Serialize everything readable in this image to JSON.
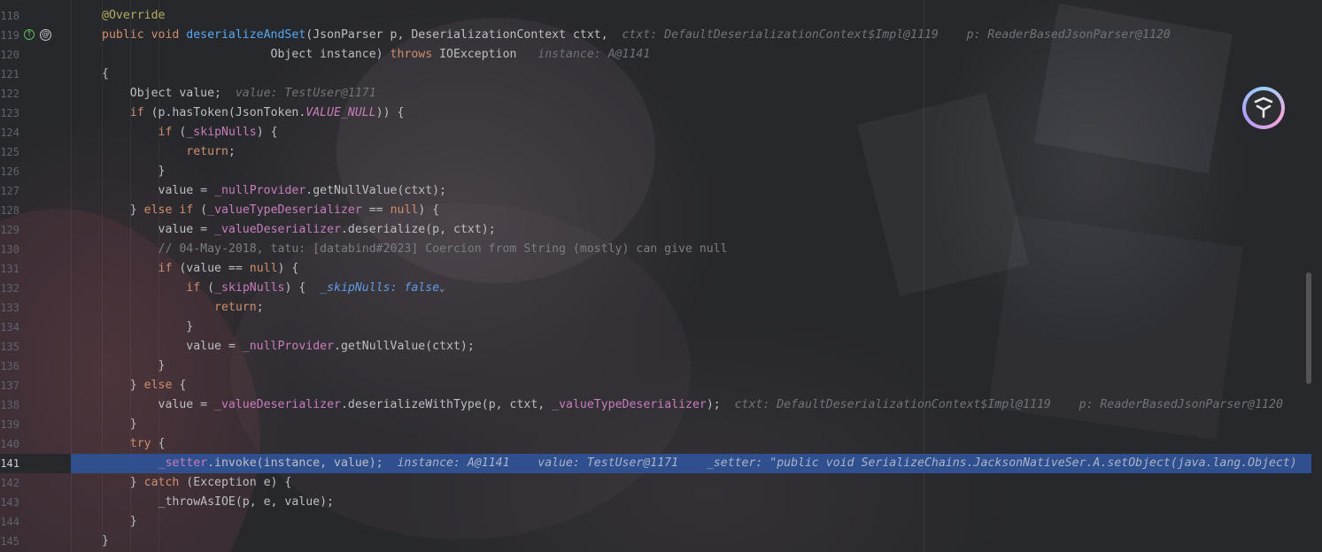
{
  "editor": {
    "lines": [
      {
        "num": "118",
        "tokens": [
          {
            "t": "@Override",
            "c": "anno"
          }
        ]
      },
      {
        "num": "119",
        "icons": [
          "override-marker",
          "annotation-marker"
        ],
        "tokens": [
          {
            "t": "public ",
            "c": "kw"
          },
          {
            "t": "void ",
            "c": "kw"
          },
          {
            "t": "deserializeAndSet",
            "c": "fn"
          },
          {
            "t": "(JsonParser p, DeserializationContext ctxt,  ",
            "c": ""
          },
          {
            "t": "ctxt: DefaultDeserializationContext$Impl@1119    p: ReaderBasedJsonParser@1120",
            "c": "hint"
          }
        ]
      },
      {
        "num": "120",
        "tokens": [
          {
            "t": "                        Object instance) ",
            "c": ""
          },
          {
            "t": "throws ",
            "c": "kw"
          },
          {
            "t": "IOException   ",
            "c": ""
          },
          {
            "t": "instance: A@1141",
            "c": "hint"
          }
        ]
      },
      {
        "num": "121",
        "tokens": [
          {
            "t": "{",
            "c": ""
          }
        ]
      },
      {
        "num": "122",
        "tokens": [
          {
            "t": "    Object value;  ",
            "c": ""
          },
          {
            "t": "value: TestUser@1171",
            "c": "hint"
          }
        ]
      },
      {
        "num": "123",
        "tokens": [
          {
            "t": "    ",
            "c": ""
          },
          {
            "t": "if ",
            "c": "kw"
          },
          {
            "t": "(p.hasToken(JsonToken.",
            "c": ""
          },
          {
            "t": "VALUE_NULL",
            "c": "const"
          },
          {
            "t": ")) {",
            "c": ""
          }
        ]
      },
      {
        "num": "124",
        "tokens": [
          {
            "t": "        ",
            "c": ""
          },
          {
            "t": "if ",
            "c": "kw"
          },
          {
            "t": "(",
            "c": ""
          },
          {
            "t": "_skipNulls",
            "c": "field"
          },
          {
            "t": ") {",
            "c": ""
          }
        ]
      },
      {
        "num": "125",
        "tokens": [
          {
            "t": "            ",
            "c": ""
          },
          {
            "t": "return",
            "c": "kw"
          },
          {
            "t": ";",
            "c": ""
          }
        ]
      },
      {
        "num": "126",
        "tokens": [
          {
            "t": "        }",
            "c": ""
          }
        ]
      },
      {
        "num": "127",
        "tokens": [
          {
            "t": "        value = ",
            "c": ""
          },
          {
            "t": "_nullProvider",
            "c": "field"
          },
          {
            "t": ".getNullValue(ctxt);",
            "c": ""
          }
        ]
      },
      {
        "num": "128",
        "tokens": [
          {
            "t": "    } ",
            "c": ""
          },
          {
            "t": "else if ",
            "c": "kw"
          },
          {
            "t": "(",
            "c": ""
          },
          {
            "t": "_valueTypeDeserializer",
            "c": "field"
          },
          {
            "t": " == ",
            "c": ""
          },
          {
            "t": "null",
            "c": "kw"
          },
          {
            "t": ") {",
            "c": ""
          }
        ]
      },
      {
        "num": "129",
        "tokens": [
          {
            "t": "        value = ",
            "c": ""
          },
          {
            "t": "_valueDeserializer",
            "c": "field"
          },
          {
            "t": ".deserialize(p, ctxt);",
            "c": ""
          }
        ]
      },
      {
        "num": "130",
        "tokens": [
          {
            "t": "        // 04-May-2018, tatu: [databind#2023] Coercion from String (mostly) can give null",
            "c": "cmt"
          }
        ]
      },
      {
        "num": "131",
        "tokens": [
          {
            "t": "        ",
            "c": ""
          },
          {
            "t": "if ",
            "c": "kw"
          },
          {
            "t": "(value == ",
            "c": ""
          },
          {
            "t": "null",
            "c": "kw"
          },
          {
            "t": ") {",
            "c": ""
          }
        ]
      },
      {
        "num": "132",
        "tokens": [
          {
            "t": "            ",
            "c": ""
          },
          {
            "t": "if ",
            "c": "kw"
          },
          {
            "t": "(",
            "c": ""
          },
          {
            "t": "_skipNulls",
            "c": "field"
          },
          {
            "t": ") {  ",
            "c": ""
          },
          {
            "t": "_skipNulls: false",
            "c": "hint-val"
          }
        ],
        "chevron": "⌄"
      },
      {
        "num": "133",
        "tokens": [
          {
            "t": "                ",
            "c": ""
          },
          {
            "t": "return",
            "c": "kw"
          },
          {
            "t": ";",
            "c": ""
          }
        ]
      },
      {
        "num": "134",
        "tokens": [
          {
            "t": "            }",
            "c": ""
          }
        ]
      },
      {
        "num": "135",
        "tokens": [
          {
            "t": "            value = ",
            "c": ""
          },
          {
            "t": "_nullProvider",
            "c": "field"
          },
          {
            "t": ".getNullValue(ctxt);",
            "c": ""
          }
        ]
      },
      {
        "num": "136",
        "tokens": [
          {
            "t": "        }",
            "c": ""
          }
        ]
      },
      {
        "num": "137",
        "tokens": [
          {
            "t": "    } ",
            "c": ""
          },
          {
            "t": "else ",
            "c": "kw"
          },
          {
            "t": "{",
            "c": ""
          }
        ]
      },
      {
        "num": "138",
        "tokens": [
          {
            "t": "        value = ",
            "c": ""
          },
          {
            "t": "_valueDeserializer",
            "c": "field"
          },
          {
            "t": ".deserializeWithType(p, ctxt, ",
            "c": ""
          },
          {
            "t": "_valueTypeDeserializer",
            "c": "field"
          },
          {
            "t": ");  ",
            "c": ""
          },
          {
            "t": "ctxt: DefaultDeserializationContext$Impl@1119    p: ReaderBasedJsonParser@1120",
            "c": "hint"
          }
        ]
      },
      {
        "num": "139",
        "tokens": [
          {
            "t": "    }",
            "c": ""
          }
        ]
      },
      {
        "num": "140",
        "tokens": [
          {
            "t": "    ",
            "c": ""
          },
          {
            "t": "try ",
            "c": "kw"
          },
          {
            "t": "{",
            "c": ""
          }
        ]
      },
      {
        "num": "141",
        "current": true,
        "tokens": [
          {
            "t": "        ",
            "c": ""
          },
          {
            "t": "_setter",
            "c": "field"
          },
          {
            "t": ".invoke(instance, value);  ",
            "c": ""
          },
          {
            "t": "instance: A@1141    value: TestUser@1171    _setter: \"public void SerializeChains.JacksonNativeSer.A.setObject(java.lang.Object)",
            "c": "hint"
          }
        ]
      },
      {
        "num": "142",
        "tokens": [
          {
            "t": "    } ",
            "c": ""
          },
          {
            "t": "catch ",
            "c": "kw"
          },
          {
            "t": "(Exception e) {",
            "c": ""
          }
        ]
      },
      {
        "num": "143",
        "tokens": [
          {
            "t": "        _throwAsIOE(p, e, value);",
            "c": ""
          }
        ]
      },
      {
        "num": "144",
        "tokens": [
          {
            "t": "    }",
            "c": ""
          }
        ]
      },
      {
        "num": "145",
        "tokens": [
          {
            "t": "}",
            "c": ""
          }
        ]
      }
    ]
  },
  "colors": {
    "current_line": "#2f4f8f",
    "keyword": "#cf8e6d",
    "method": "#56a8f5",
    "field": "#c77dbb",
    "annotation": "#b3ae60",
    "comment": "#7a7e85"
  },
  "gutter_icons": [
    "override-marker-icon",
    "annotation-marker-icon"
  ],
  "floating_badge": {
    "icon": "ai-assistant-logo-icon"
  }
}
